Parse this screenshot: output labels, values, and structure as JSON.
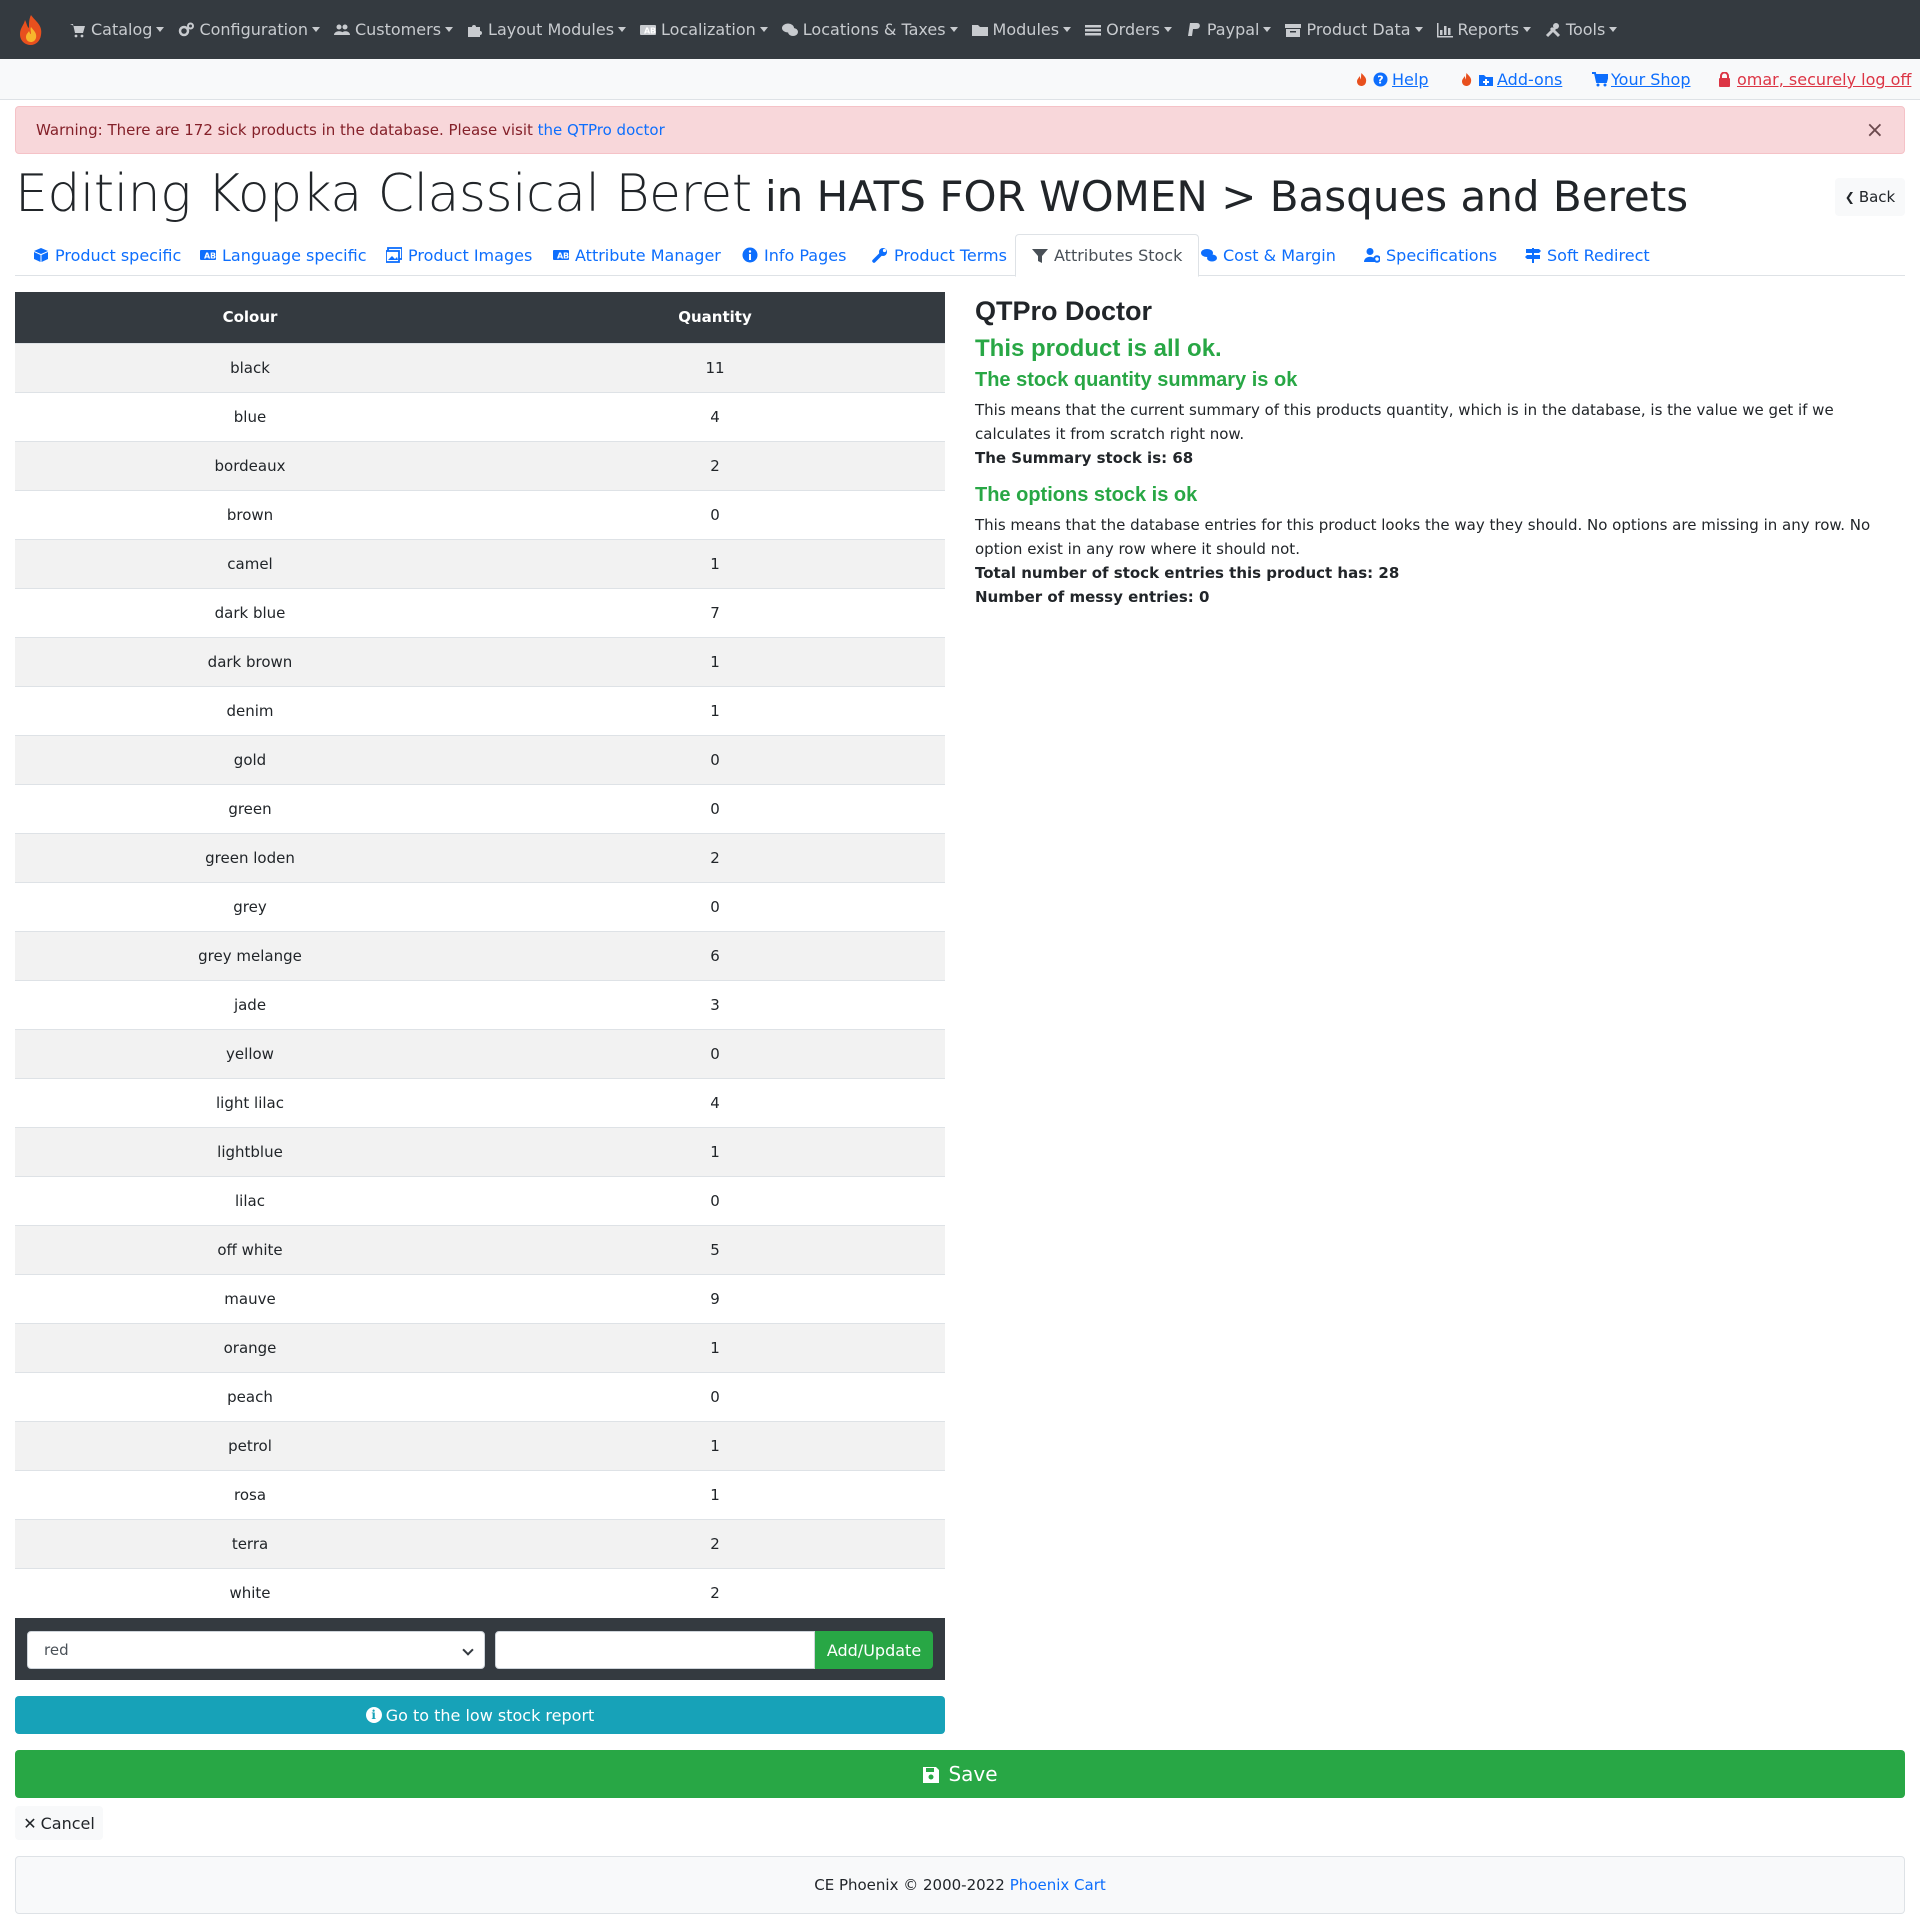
{
  "navbar": {
    "items": [
      {
        "label": "Catalog",
        "icon": "cart-icon"
      },
      {
        "label": "Configuration",
        "icon": "cogs-icon"
      },
      {
        "label": "Customers",
        "icon": "users-icon"
      },
      {
        "label": "Layout Modules",
        "icon": "puzzle-icon"
      },
      {
        "label": "Localization",
        "icon": "language-icon"
      },
      {
        "label": "Locations & Taxes",
        "icon": "chat-icon"
      },
      {
        "label": "Modules",
        "icon": "folder-icon"
      },
      {
        "label": "Orders",
        "icon": "list-icon"
      },
      {
        "label": "Paypal",
        "icon": "paypal-icon"
      },
      {
        "label": "Product Data",
        "icon": "archive-icon"
      },
      {
        "label": "Reports",
        "icon": "chart-icon"
      },
      {
        "label": "Tools",
        "icon": "tools-icon"
      }
    ]
  },
  "subbar": {
    "help": "Help",
    "addons": "Add-ons",
    "shop": "Your Shop",
    "logoff": "omar, securely log off"
  },
  "alert": {
    "text": "Warning: There are 172 sick products in the database. Please visit ",
    "link": "the QTPro doctor",
    "close": "×"
  },
  "heading": {
    "main": "Editing Kopka Classical Beret",
    "rest": " in HATS FOR WOMEN > Basques and Berets",
    "back": "Back"
  },
  "tabs": [
    {
      "label": "Product specific",
      "icon": "box-icon"
    },
    {
      "label": "Language specific",
      "icon": "language-icon"
    },
    {
      "label": "Product Images",
      "icon": "images-icon"
    },
    {
      "label": "Attribute Manager",
      "icon": "language-icon"
    },
    {
      "label": "Info Pages",
      "icon": "info-icon"
    },
    {
      "label": "Product Terms",
      "icon": "wrench-icon"
    },
    {
      "label": "Attributes Stock",
      "icon": "filter-icon",
      "active": true
    },
    {
      "label": "Cost & Margin",
      "icon": "coins-icon"
    },
    {
      "label": "Specifications",
      "icon": "user-cog-icon"
    },
    {
      "label": "Soft Redirect",
      "icon": "signs-icon"
    }
  ],
  "stock_table": {
    "headers": [
      "Colour",
      "Quantity"
    ],
    "rows": [
      [
        "black",
        "11"
      ],
      [
        "blue",
        "4"
      ],
      [
        "bordeaux",
        "2"
      ],
      [
        "brown",
        "0"
      ],
      [
        "camel",
        "1"
      ],
      [
        "dark blue",
        "7"
      ],
      [
        "dark brown",
        "1"
      ],
      [
        "denim",
        "1"
      ],
      [
        "gold",
        "0"
      ],
      [
        "green",
        "0"
      ],
      [
        "green loden",
        "2"
      ],
      [
        "grey",
        "0"
      ],
      [
        "grey melange",
        "6"
      ],
      [
        "jade",
        "3"
      ],
      [
        "yellow",
        "0"
      ],
      [
        "light lilac",
        "4"
      ],
      [
        "lightblue",
        "1"
      ],
      [
        "lilac",
        "0"
      ],
      [
        "off white",
        "5"
      ],
      [
        "mauve",
        "9"
      ],
      [
        "orange",
        "1"
      ],
      [
        "peach",
        "0"
      ],
      [
        "petrol",
        "1"
      ],
      [
        "rosa",
        "1"
      ],
      [
        "terra",
        "2"
      ],
      [
        "white",
        "2"
      ]
    ]
  },
  "add_form": {
    "selected_colour": "red",
    "quantity_value": "",
    "button": "Add/Update"
  },
  "low_stock_button": "Go to the low stock report",
  "save_button": "Save",
  "cancel_button": "Cancel",
  "footer": {
    "text": "CE Phoenix © 2000-2022",
    "link": "Phoenix Cart"
  },
  "doctor": {
    "title": "QTPro Doctor",
    "status": "This product is all ok.",
    "summary_heading": "The stock quantity summary is ok",
    "summary_text": "This means that the current summary of this products quantity, which is in the database, is the value we get if we calculates it from scratch right now.",
    "summary_stock": "The Summary stock is: 68",
    "options_heading": "The options stock is ok",
    "options_text": "This means that the database entries for this product looks the way they should. No options are missing in any row. No option exist in any row where it should not.",
    "total_entries": "Total number of stock entries this product has: 28",
    "messy_entries": "Number of messy entries: 0"
  },
  "colors": {
    "navbar": "#343a40",
    "link": "#0d6efd",
    "success": "#28a745",
    "info": "#17a2b8",
    "alert_bg": "#f8d7da"
  }
}
